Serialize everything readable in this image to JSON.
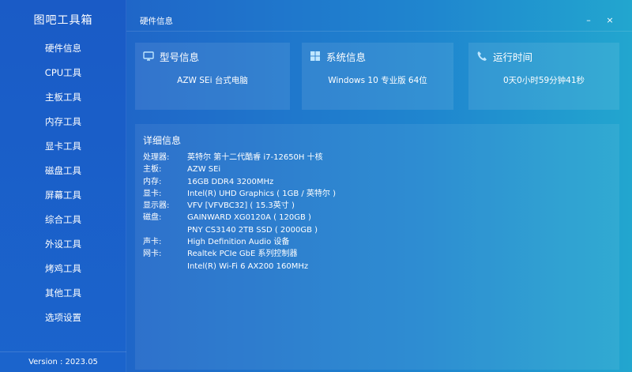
{
  "app": {
    "title": "图吧工具箱",
    "version": "Version : 2023.05"
  },
  "sidebar": {
    "items": [
      {
        "label": "硬件信息"
      },
      {
        "label": "CPU工具"
      },
      {
        "label": "主板工具"
      },
      {
        "label": "内存工具"
      },
      {
        "label": "显卡工具"
      },
      {
        "label": "磁盘工具"
      },
      {
        "label": "屏幕工具"
      },
      {
        "label": "综合工具"
      },
      {
        "label": "外设工具"
      },
      {
        "label": "烤鸡工具"
      },
      {
        "label": "其他工具"
      },
      {
        "label": "选项设置"
      }
    ]
  },
  "titlebar": {
    "title": "硬件信息",
    "min_label": "–",
    "close_label": "×"
  },
  "cards": [
    {
      "label": "型号信息",
      "value": "AZW SEi 台式电脑",
      "icon": "monitor-icon"
    },
    {
      "label": "系统信息",
      "value": "Windows 10 专业版 64位",
      "icon": "windows-icon"
    },
    {
      "label": "运行时间",
      "value": "0天0小时59分钟41秒",
      "icon": "phone-icon"
    }
  ],
  "detail": {
    "title": "详细信息",
    "rows": [
      {
        "k": "处理器:",
        "v": "英特尔 第十二代酷睿 i7-12650H 十核"
      },
      {
        "k": "主板:",
        "v": "AZW SEi"
      },
      {
        "k": "内存:",
        "v": "16GB DDR4 3200MHz"
      },
      {
        "k": "显卡:",
        "v": "Intel(R) UHD Graphics ( 1GB / 英特尔 )"
      },
      {
        "k": "显示器:",
        "v": "VFV [VFVBC32] ( 15.3英寸 )"
      },
      {
        "k": "磁盘:",
        "v": "GAINWARD XG0120A ( 120GB )"
      },
      {
        "k": "",
        "v": "PNY CS3140 2TB SSD ( 2000GB )"
      },
      {
        "k": "声卡:",
        "v": "High Definition Audio 设备"
      },
      {
        "k": "网卡:",
        "v": "Realtek PCIe GbE 系列控制器"
      },
      {
        "k": "",
        "v": "Intel(R) Wi-Fi 6 AX200 160MHz"
      }
    ]
  },
  "colors": {
    "sidebar_bg": "#1a5bc6",
    "main_gradient_start": "#1f66c8",
    "main_gradient_end": "#22a6cf"
  }
}
